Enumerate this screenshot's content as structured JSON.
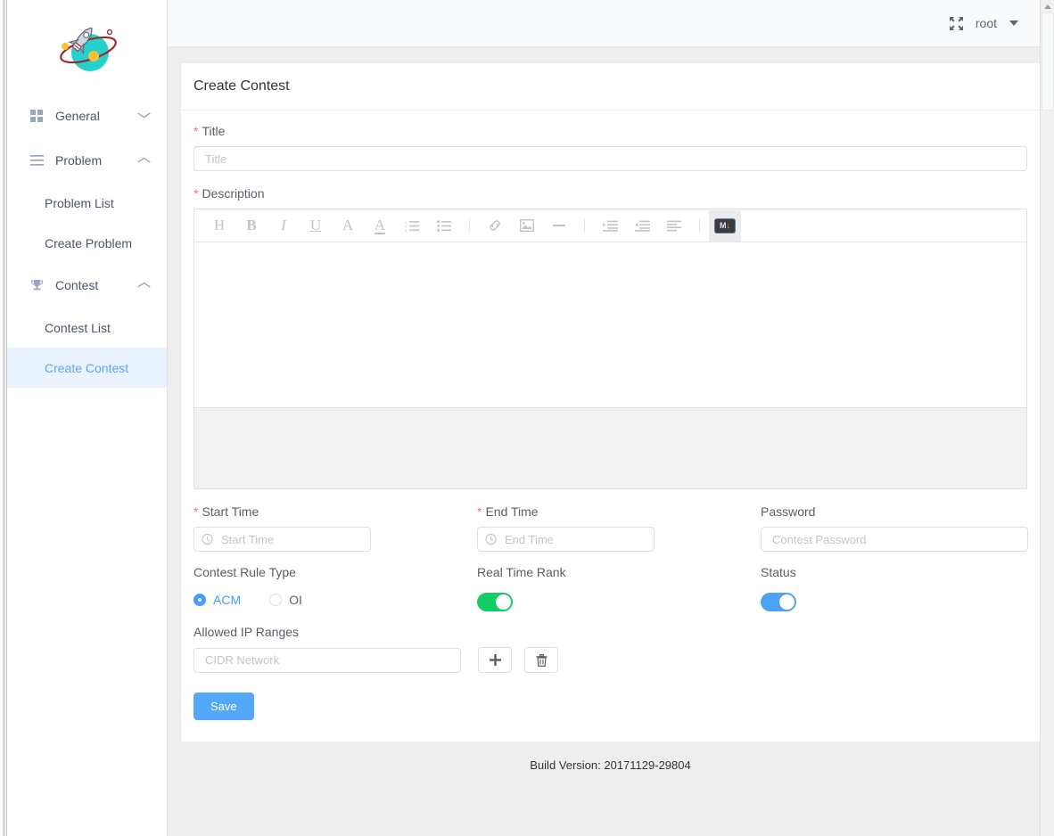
{
  "brand": {
    "logo_icon": "rocket-planet-logo"
  },
  "sidebar": {
    "groups": [
      {
        "label": "General",
        "icon": "grid-icon",
        "arrow": "chevron-down-icon",
        "children": []
      },
      {
        "label": "Problem",
        "icon": "list-lines-icon",
        "arrow": "chevron-up-icon",
        "children": [
          "Problem List",
          "Create Problem"
        ]
      },
      {
        "label": "Contest",
        "icon": "trophy-icon",
        "arrow": "chevron-up-icon",
        "children": [
          "Contest List",
          "Create Contest"
        ]
      }
    ],
    "active_item": "Create Contest"
  },
  "topbar": {
    "fullscreen_icon": "fullscreen-expand-icon",
    "user": "root",
    "caret_icon": "caret-down-icon"
  },
  "page": {
    "title": "Create Contest"
  },
  "form": {
    "title": {
      "label": "Title",
      "required": true,
      "value": "",
      "placeholder": "Title"
    },
    "description": {
      "label": "Description",
      "required": true,
      "value": ""
    },
    "start_time": {
      "label": "Start Time",
      "required": true,
      "value": "",
      "placeholder": "Start Time",
      "icon": "clock-icon"
    },
    "end_time": {
      "label": "End Time",
      "required": true,
      "value": "",
      "placeholder": "End Time",
      "icon": "clock-icon"
    },
    "password": {
      "label": "Password",
      "required": false,
      "value": "",
      "placeholder": "Contest Password"
    },
    "rule_type": {
      "label": "Contest Rule Type",
      "options": [
        "ACM",
        "OI"
      ],
      "selected": "ACM"
    },
    "real_time_rank": {
      "label": "Real Time Rank",
      "on": true,
      "color": "#13ce66"
    },
    "status": {
      "label": "Status",
      "on": true,
      "color": "#409eff"
    },
    "allowed_ip": {
      "label": "Allowed IP Ranges",
      "value": "",
      "placeholder": "CIDR Network",
      "add_icon": "plus-icon",
      "delete_icon": "trash-icon"
    },
    "save_label": "Save"
  },
  "editor": {
    "toolbar": [
      {
        "name": "heading-icon",
        "glyph": "H"
      },
      {
        "name": "bold-icon",
        "glyph": "B"
      },
      {
        "name": "italic-icon",
        "glyph": "I"
      },
      {
        "name": "underline-icon",
        "glyph": "U"
      },
      {
        "name": "font-size-icon",
        "glyph": "A"
      },
      {
        "name": "font-color-icon",
        "glyph": "A"
      },
      {
        "name": "ordered-list-icon",
        "glyph": "ol"
      },
      {
        "name": "unordered-list-icon",
        "glyph": "ul"
      },
      {
        "name": "separator",
        "glyph": "|"
      },
      {
        "name": "link-icon",
        "glyph": "link"
      },
      {
        "name": "image-icon",
        "glyph": "image"
      },
      {
        "name": "horizontal-rule-icon",
        "glyph": "hr"
      },
      {
        "name": "separator",
        "glyph": "|"
      },
      {
        "name": "indent-icon",
        "glyph": "indent"
      },
      {
        "name": "outdent-icon",
        "glyph": "outdent"
      },
      {
        "name": "align-left-icon",
        "glyph": "align"
      },
      {
        "name": "separator",
        "glyph": "|"
      },
      {
        "name": "markdown-icon",
        "glyph": "M",
        "active": true
      }
    ],
    "markdown_label_m": "M",
    "markdown_label_arrow": "↓",
    "content": ""
  },
  "footer": {
    "build_version": "Build Version: 20171129-29804"
  },
  "colors": {
    "accent_blue": "#409eff",
    "switch_green": "#13ce66",
    "required_red": "#ff6b6b",
    "active_bg": "#eaf2fd"
  }
}
